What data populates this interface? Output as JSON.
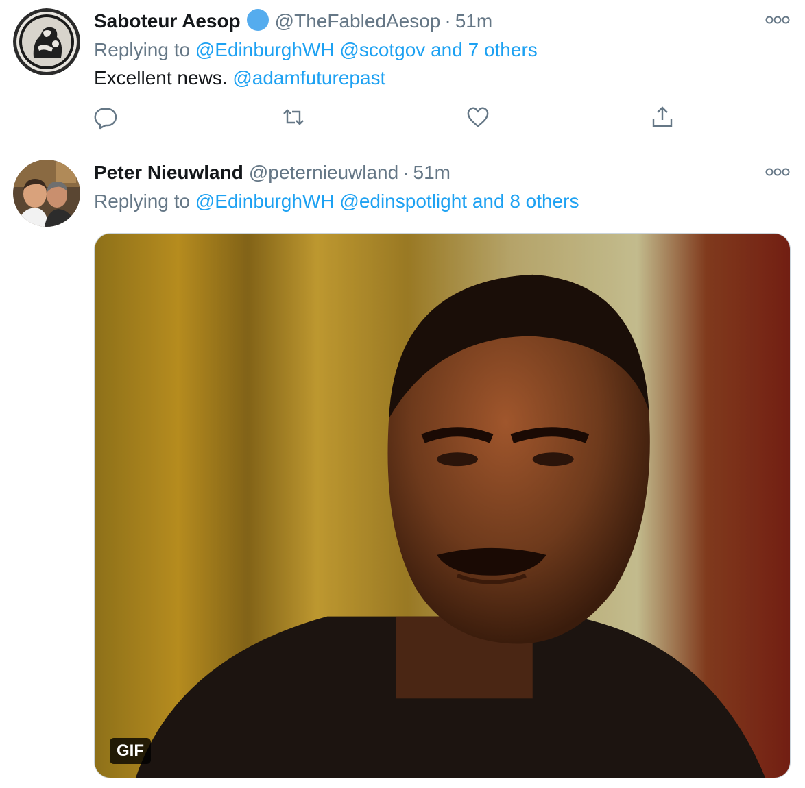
{
  "tweets": [
    {
      "author": {
        "name": "Saboteur Aesop",
        "handle": "@TheFabledAesop",
        "verified": true,
        "avatar": "aesop-vase-avatar"
      },
      "dot": "·",
      "time": "51m",
      "reply": {
        "prefix": "Replying to",
        "mention1": "@EdinburghWH",
        "mention2": "@scotgov",
        "others": "and 7 others"
      },
      "text": {
        "plain": "Excellent news.",
        "mention": "@adamfuturepast"
      },
      "actions": [
        "reply-icon",
        "retweet-icon",
        "like-icon",
        "share-icon"
      ]
    },
    {
      "author": {
        "name": "Peter Nieuwland",
        "handle": "@peternieuwland",
        "verified": false,
        "avatar": "two-men-photo-avatar"
      },
      "dot": "·",
      "time": "51m",
      "reply": {
        "prefix": "Replying to",
        "mention1": "@EdinburghWH",
        "mention2": "@edinspotlight",
        "others": "and 8 others"
      },
      "media": {
        "type": "gif",
        "badge": "GIF",
        "description_icon": "man-portrait-gif"
      }
    }
  ],
  "colors": {
    "accent": "#1da1f2",
    "secondary_text": "#657786",
    "primary_text": "#14171a",
    "divider": "#e6ecf0"
  }
}
